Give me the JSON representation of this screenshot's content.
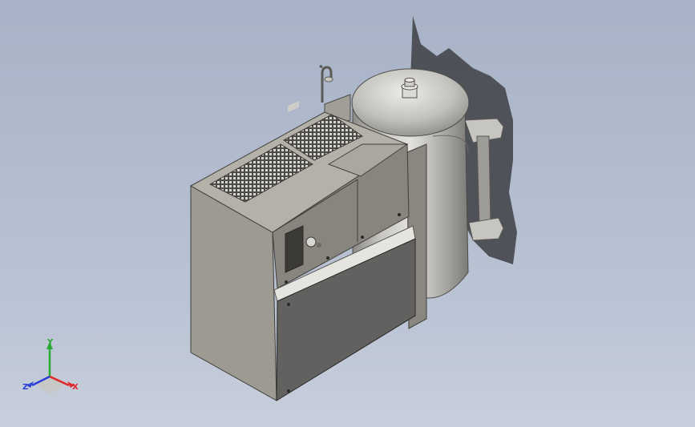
{
  "viewport": {
    "background_top": "#a7b2c6",
    "background_bottom": "#c8cfdc"
  },
  "model": {
    "body_color": "#8f8c84",
    "tank_color": "#b9b7b2",
    "shadow_color": "#4a4c52"
  },
  "triad": {
    "x_label": "X",
    "y_label": "Y",
    "z_label": "Z",
    "x_color": "#e0262a",
    "y_color": "#2aa834",
    "z_color": "#2a3ed8"
  }
}
